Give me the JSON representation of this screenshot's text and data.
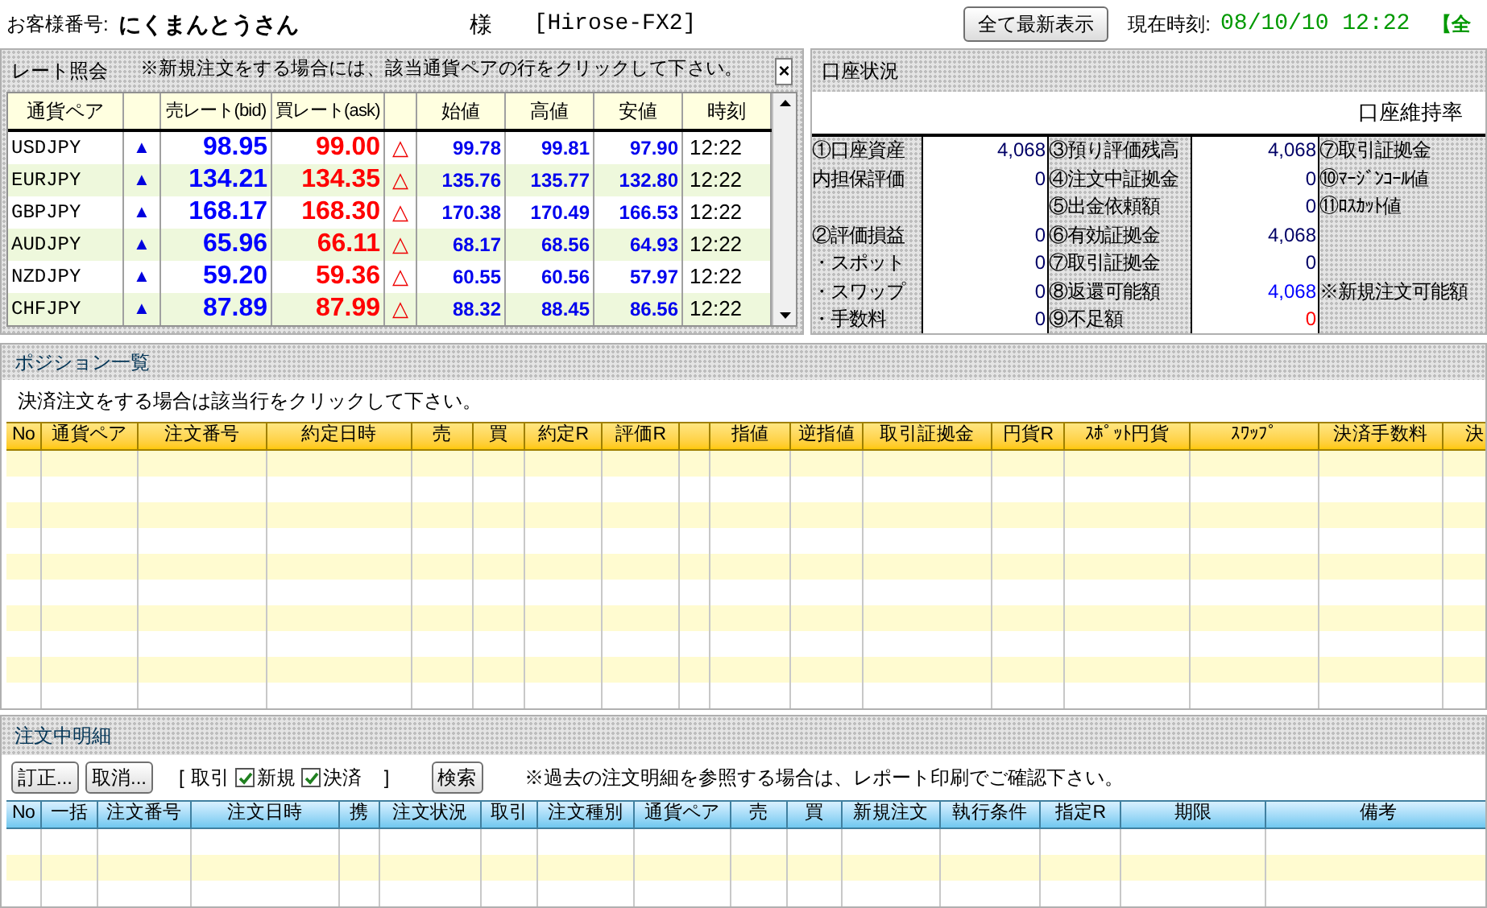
{
  "header": {
    "customer_label": "お客様番号:",
    "customer_name": "にくまんとうさん",
    "honorific": "様",
    "account": "[Hirose-FX2]",
    "refresh_button": "全て最新表示",
    "time_label": "現在時刻:",
    "time": "08/10/10 12:22",
    "cut_text": "【全"
  },
  "rates": {
    "title": "レート照会",
    "note": "※新規注文をする場合には、該当通貨ペアの行をクリックして下さい。",
    "close": "×",
    "columns": [
      "通貨ペア",
      "",
      "売レート(bid)",
      "買レート(ask)",
      "",
      "始値",
      "高値",
      "安値",
      "時刻"
    ],
    "rows": [
      {
        "pair": "USDJPY",
        "bid_mark": "▲",
        "bid": "98.95",
        "ask": "99.00",
        "ask_mark": "△",
        "open": "99.78",
        "high": "99.81",
        "low": "97.90",
        "time": "12:22"
      },
      {
        "pair": "EURJPY",
        "bid_mark": "▲",
        "bid": "134.21",
        "ask": "134.35",
        "ask_mark": "△",
        "open": "135.76",
        "high": "135.77",
        "low": "132.80",
        "time": "12:22"
      },
      {
        "pair": "GBPJPY",
        "bid_mark": "▲",
        "bid": "168.17",
        "ask": "168.30",
        "ask_mark": "△",
        "open": "170.38",
        "high": "170.49",
        "low": "166.53",
        "time": "12:22"
      },
      {
        "pair": "AUDJPY",
        "bid_mark": "▲",
        "bid": "65.96",
        "ask": "66.11",
        "ask_mark": "△",
        "open": "68.17",
        "high": "68.56",
        "low": "64.93",
        "time": "12:22"
      },
      {
        "pair": "NZDJPY",
        "bid_mark": "▲",
        "bid": "59.20",
        "ask": "59.36",
        "ask_mark": "△",
        "open": "60.55",
        "high": "60.56",
        "low": "57.97",
        "time": "12:22"
      },
      {
        "pair": "CHFJPY",
        "bid_mark": "▲",
        "bid": "87.89",
        "ask": "87.99",
        "ask_mark": "△",
        "open": "88.32",
        "high": "88.45",
        "low": "86.56",
        "time": "12:22"
      }
    ]
  },
  "account": {
    "title": "口座状況",
    "ratio_label": "口座維持率",
    "rows": [
      [
        {
          "kind": "label",
          "text": "①口座資産"
        },
        {
          "kind": "value",
          "text": "4,068",
          "color": "#000066"
        },
        {
          "kind": "label",
          "text": "③預り評価残高"
        },
        {
          "kind": "value",
          "text": "4,068",
          "color": "#000066"
        },
        {
          "kind": "label",
          "text": "⑦取引証拠金"
        }
      ],
      [
        {
          "kind": "label",
          "text": "内担保評価"
        },
        {
          "kind": "value",
          "text": "0",
          "color": "#000066"
        },
        {
          "kind": "label",
          "text": "④注文中証拠金"
        },
        {
          "kind": "value",
          "text": "0",
          "color": "#000066"
        },
        {
          "kind": "label",
          "text": "⑩ﾏｰｼﾞﾝｺｰﾙ値"
        }
      ],
      [
        {
          "kind": "label"
        },
        {
          "kind": "value"
        },
        {
          "kind": "label",
          "text": "⑤出金依頼額"
        },
        {
          "kind": "value",
          "text": "0",
          "color": "#000066"
        },
        {
          "kind": "label",
          "text": "⑪ﾛｽｶｯﾄ値"
        }
      ],
      [
        {
          "kind": "label",
          "text": "②評価損益"
        },
        {
          "kind": "value",
          "text": "0",
          "color": "#000066"
        },
        {
          "kind": "label",
          "text": "⑥有効証拠金"
        },
        {
          "kind": "value",
          "text": "4,068",
          "color": "#000066"
        },
        {
          "kind": "label"
        }
      ],
      [
        {
          "kind": "label",
          "text": "・スポット"
        },
        {
          "kind": "value",
          "text": "0",
          "color": "#000066"
        },
        {
          "kind": "label",
          "text": "⑦取引証拠金"
        },
        {
          "kind": "value",
          "text": "0",
          "color": "#000066"
        },
        {
          "kind": "label"
        }
      ],
      [
        {
          "kind": "label",
          "text": "・スワップ"
        },
        {
          "kind": "value",
          "text": "0",
          "color": "#000066"
        },
        {
          "kind": "label",
          "text": "⑧返還可能額"
        },
        {
          "kind": "value",
          "text": "4,068",
          "color": "#0000ff"
        },
        {
          "kind": "label",
          "text": "※新規注文可能額"
        }
      ],
      [
        {
          "kind": "label",
          "text": "・手数料"
        },
        {
          "kind": "value",
          "text": "0",
          "color": "#000066"
        },
        {
          "kind": "label",
          "text": "⑨不足額"
        },
        {
          "kind": "value",
          "text": "0",
          "color": "#ff0000"
        },
        {
          "kind": "label"
        }
      ]
    ]
  },
  "positions": {
    "title": "ポジション一覧",
    "note": "決済注文をする場合は該当行をクリックして下さい。",
    "columns": [
      "No",
      "通貨ペア",
      "注文番号",
      "約定日時",
      "売",
      "買",
      "約定R",
      "評価R",
      "",
      "指値",
      "逆指値",
      "取引証拠金",
      "円貨R",
      "ｽﾎﾟｯﾄ円貨",
      "ｽﾜｯﾌﾟ",
      "決済手数料",
      "決"
    ]
  },
  "orders": {
    "title": "注文中明細",
    "buttons": [
      "訂正...",
      "取消..."
    ],
    "bracket_open": "[",
    "filter_label": "取引",
    "filters": [
      {
        "label": "新規",
        "checked": true
      },
      {
        "label": "決済",
        "checked": true
      }
    ],
    "bracket_close": "]",
    "search_button": "検索",
    "note": "※過去の注文明細を参照する場合は、レポート印刷でご確認下さい。",
    "columns": [
      "No",
      "一括",
      "注文番号",
      "注文日時",
      "携",
      "注文状況",
      "取引",
      "注文種別",
      "通貨ペア",
      "売",
      "買",
      "新規注文",
      "執行条件",
      "指定R",
      "期限",
      "備考"
    ]
  }
}
